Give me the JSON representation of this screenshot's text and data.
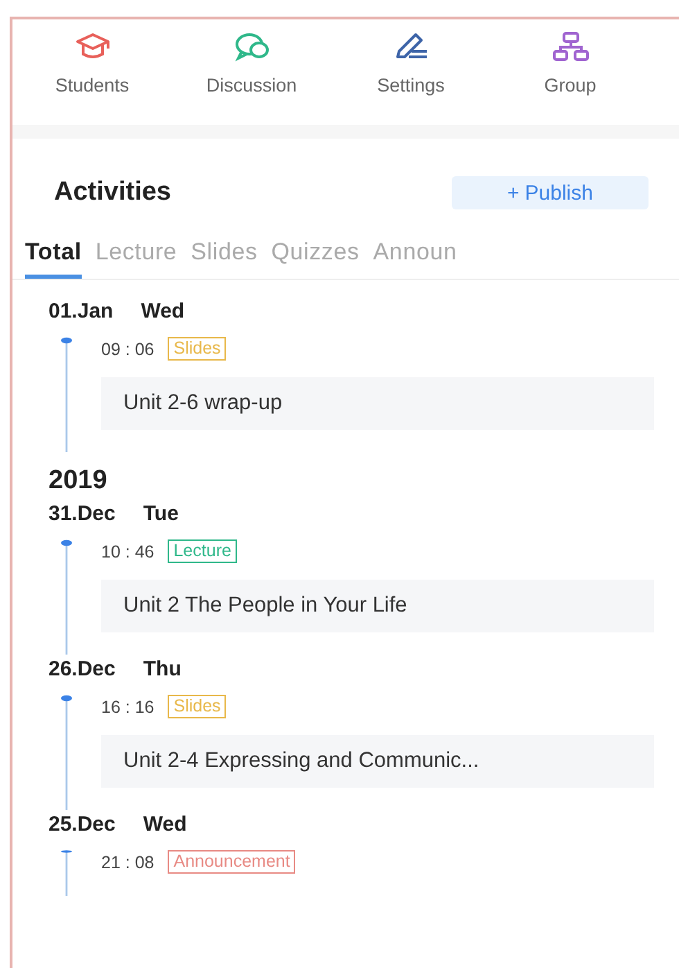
{
  "nav": [
    {
      "kind": "students",
      "label": "Students"
    },
    {
      "kind": "discussion",
      "label": "Discussion"
    },
    {
      "kind": "settings",
      "label": "Settings"
    },
    {
      "kind": "group",
      "label": "Group"
    }
  ],
  "activities": {
    "title": "Activities",
    "publish": {
      "icon": "+",
      "label": "Publish"
    }
  },
  "tabs": [
    {
      "label": "Total",
      "selected": true
    },
    {
      "label": "Lecture",
      "selected": false
    },
    {
      "label": "Slides",
      "selected": false
    },
    {
      "label": "Quizzes",
      "selected": false
    },
    {
      "label": "Announ",
      "selected": false
    }
  ],
  "days": [
    {
      "date": "01.Jan",
      "weekday": "Wed",
      "entries": [
        {
          "time": "09 : 06",
          "tag": "Slides",
          "color": "#e8b84a",
          "title": "Unit 2-6 wrap-up"
        }
      ]
    },
    {
      "year": "2019",
      "date": "31.Dec",
      "weekday": "Tue",
      "entries": [
        {
          "time": "10 : 46",
          "tag": "Lecture",
          "color": "#2fb88a",
          "title": "Unit 2 The People in Your Life"
        }
      ]
    },
    {
      "date": "26.Dec",
      "weekday": "Thu",
      "entries": [
        {
          "time": "16 : 16",
          "tag": "Slides",
          "color": "#e8b84a",
          "title": "Unit 2-4 Expressing and Communic..."
        }
      ]
    },
    {
      "date": "25.Dec",
      "weekday": "Wed",
      "entries": [
        {
          "time": "21 : 08",
          "tag": "Announcement",
          "color": "#e88a84"
        }
      ]
    }
  ]
}
